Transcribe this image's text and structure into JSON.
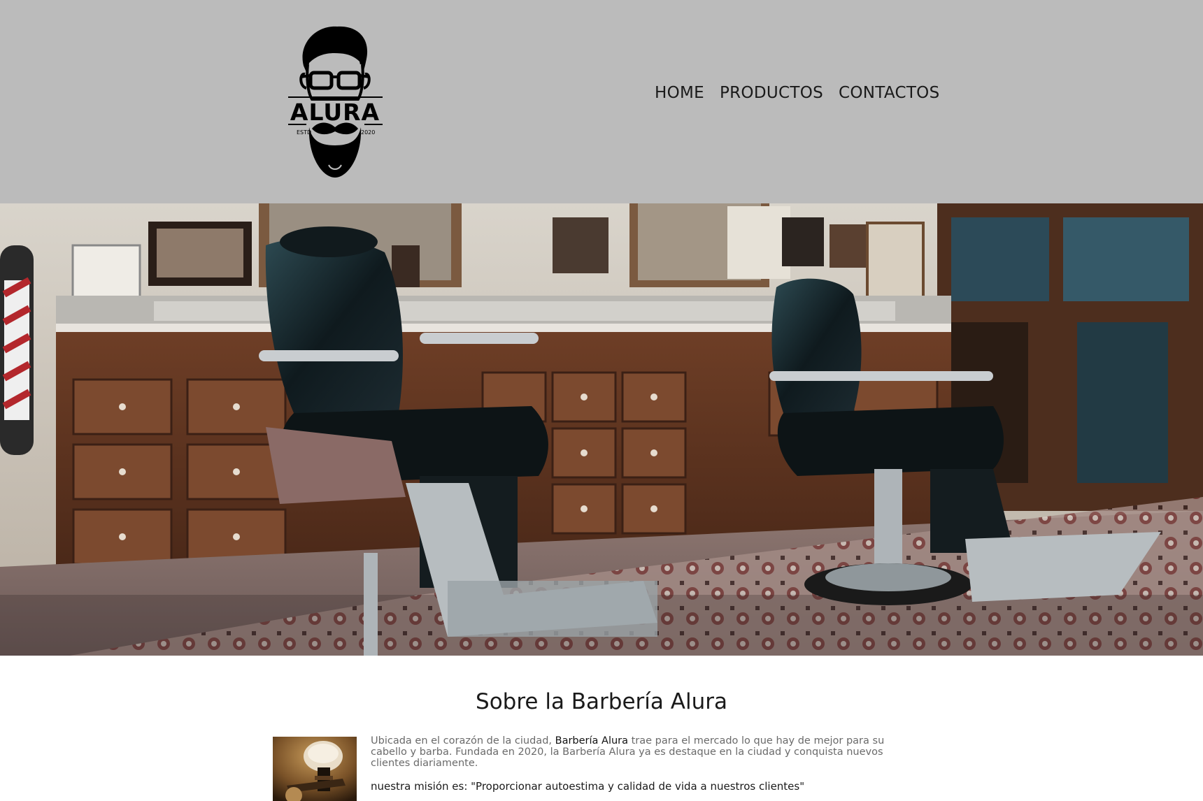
{
  "header": {
    "logo": {
      "brand": "ALURA",
      "estd": "ESTD",
      "year": "2020"
    },
    "nav": [
      {
        "label": "HOME"
      },
      {
        "label": "PRODUCTOS"
      },
      {
        "label": "CONTACTOS"
      }
    ]
  },
  "hero": {
    "image": "barbershop-interior-photo"
  },
  "about": {
    "title": "Sobre la Barbería Alura",
    "text_before": "Ubicada en el corazón de la ciudad, ",
    "brand": "Barbería Alura",
    "text_after": " trae para el mercado lo que hay de mejor para su cabello y barba. Fundada en 2020, la Barbería Alura ya es destaque en la ciudad y conquista nuevos clientes diariamente.",
    "mission": "nuestra misión es: \"Proporcionar autoestima y calidad de vida a nuestros clientes\""
  },
  "colors": {
    "header_bg": "#bbbbbb",
    "text_dark": "#1a1a1a",
    "text_muted": "#6a6a6a"
  }
}
